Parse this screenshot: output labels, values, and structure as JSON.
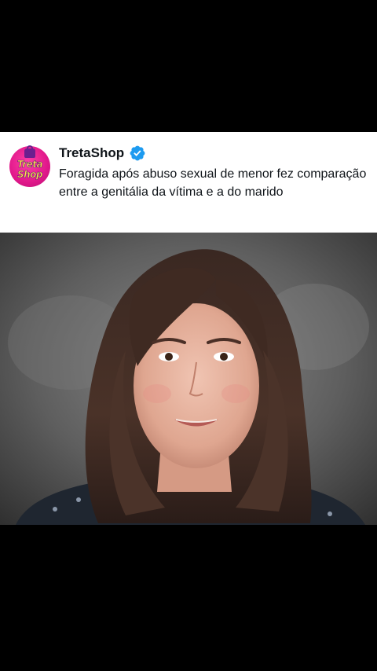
{
  "post": {
    "author_name": "TretaShop",
    "verified": true,
    "verified_icon": "verified-badge-icon",
    "verified_color": "#1d9bf0",
    "text": "Foragida após abuso sexual de menor fez comparação entre a genitália da vítima e a do marido"
  },
  "avatar": {
    "logo_line_1": "Treta",
    "logo_line_2": "Shop",
    "brand_color": "#e0188a"
  },
  "photo": {
    "icon": "portrait-photo"
  }
}
